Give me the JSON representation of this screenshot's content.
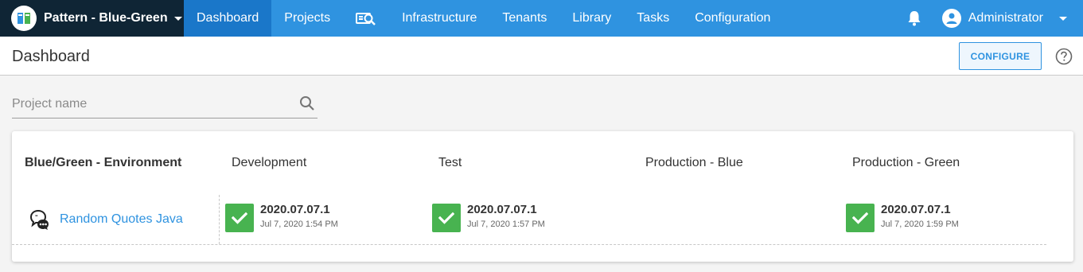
{
  "nav": {
    "space_name": "Pattern - Blue-Green",
    "items": [
      {
        "label": "Dashboard",
        "active": true
      },
      {
        "label": "Projects"
      },
      {
        "label": "Infrastructure"
      },
      {
        "label": "Tenants"
      },
      {
        "label": "Library"
      },
      {
        "label": "Tasks"
      },
      {
        "label": "Configuration"
      }
    ],
    "search_icon": "search-icon",
    "user_name": "Administrator"
  },
  "page": {
    "title": "Dashboard",
    "configure_label": "CONFIGURE"
  },
  "search": {
    "placeholder": "Project name"
  },
  "dashboard": {
    "group_header": "Blue/Green - Environment",
    "environments": [
      "Development",
      "Test",
      "Production - Blue",
      "Production - Green"
    ],
    "project": {
      "name": "Random Quotes Java",
      "deployments": [
        {
          "environment": "Development",
          "version": "2020.07.07.1",
          "date": "Jul 7, 2020 1:54 PM",
          "status": "success"
        },
        {
          "environment": "Test",
          "version": "2020.07.07.1",
          "date": "Jul 7, 2020 1:57 PM",
          "status": "success"
        },
        {
          "environment": "Production - Blue",
          "version": "",
          "date": "",
          "status": "none"
        },
        {
          "environment": "Production - Green",
          "version": "2020.07.07.1",
          "date": "Jul 7, 2020 1:59 PM",
          "status": "success"
        }
      ]
    }
  },
  "colors": {
    "nav_bg": "#2f93e0",
    "nav_active": "#1a77c9",
    "space_bg": "#0f2535",
    "success": "#48b350",
    "link": "#2f93e0"
  }
}
